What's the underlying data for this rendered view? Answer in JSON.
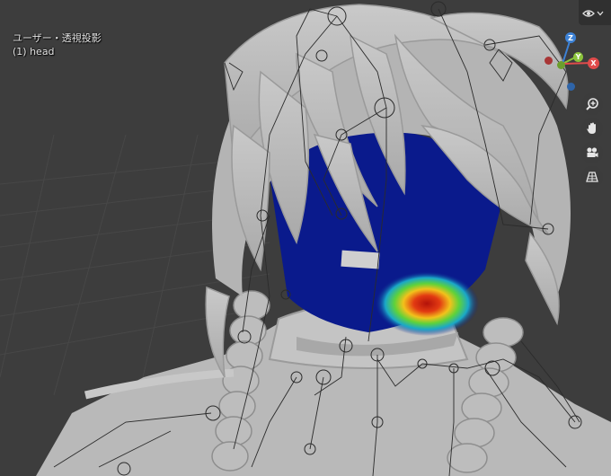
{
  "viewport": {
    "view_name": "ユーザー・透視投影",
    "active_object": "(1) head"
  },
  "header": {
    "overlay_icon": "eye-icon",
    "dropdown_icon": "chevron-down-icon"
  },
  "gizmo": {
    "z_label": "Z",
    "y_label": "Y",
    "x_label": "X",
    "colors": {
      "x": "#e04b4b",
      "y": "#8cc43c",
      "z": "#3d82d6"
    }
  },
  "nav_buttons": [
    "zoom-icon",
    "pan-hand-icon",
    "camera-icon",
    "perspective-grid-icon"
  ],
  "colors": {
    "background": "#3d3d3d",
    "mesh": "#b8b8b8",
    "weight_low": "#0a1a8c",
    "weight_high": "#d11b0d"
  }
}
